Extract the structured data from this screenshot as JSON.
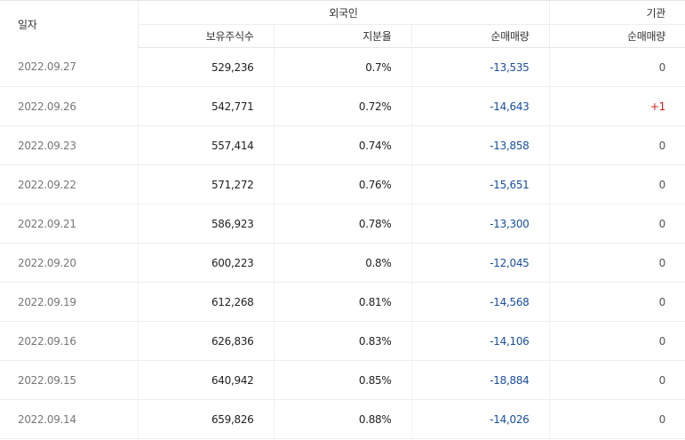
{
  "headers": {
    "date": "일자",
    "foreign": "외국인",
    "institution": "기관",
    "holdings": "보유주식수",
    "ratio": "지분율",
    "foreign_net": "순매매량",
    "institution_net": "순매매량"
  },
  "colors": {
    "negative": "#1a4fa0",
    "positive": "#d61c1c",
    "date_text": "#777777"
  },
  "rows": [
    {
      "date": "2022.09.27",
      "holdings": "529,236",
      "ratio": "0.7%",
      "foreign_net": "-13,535",
      "institution_net": "0"
    },
    {
      "date": "2022.09.26",
      "holdings": "542,771",
      "ratio": "0.72%",
      "foreign_net": "-14,643",
      "institution_net": "+1"
    },
    {
      "date": "2022.09.23",
      "holdings": "557,414",
      "ratio": "0.74%",
      "foreign_net": "-13,858",
      "institution_net": "0"
    },
    {
      "date": "2022.09.22",
      "holdings": "571,272",
      "ratio": "0.76%",
      "foreign_net": "-15,651",
      "institution_net": "0"
    },
    {
      "date": "2022.09.21",
      "holdings": "586,923",
      "ratio": "0.78%",
      "foreign_net": "-13,300",
      "institution_net": "0"
    },
    {
      "date": "2022.09.20",
      "holdings": "600,223",
      "ratio": "0.8%",
      "foreign_net": "-12,045",
      "institution_net": "0"
    },
    {
      "date": "2022.09.19",
      "holdings": "612,268",
      "ratio": "0.81%",
      "foreign_net": "-14,568",
      "institution_net": "0"
    },
    {
      "date": "2022.09.16",
      "holdings": "626,836",
      "ratio": "0.83%",
      "foreign_net": "-14,106",
      "institution_net": "0"
    },
    {
      "date": "2022.09.15",
      "holdings": "640,942",
      "ratio": "0.85%",
      "foreign_net": "-18,884",
      "institution_net": "0"
    },
    {
      "date": "2022.09.14",
      "holdings": "659,826",
      "ratio": "0.88%",
      "foreign_net": "-14,026",
      "institution_net": "0"
    }
  ]
}
